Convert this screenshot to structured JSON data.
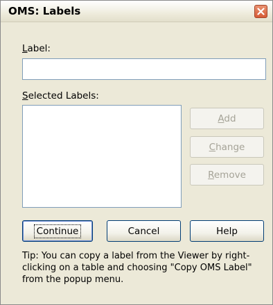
{
  "window": {
    "title": "OMS: Labels",
    "close_icon": "close-icon"
  },
  "form": {
    "label_field": {
      "label_mnemonic": "L",
      "label_rest": "abel:",
      "value": "",
      "placeholder": ""
    },
    "selected_labels": {
      "label_mnemonic": "S",
      "label_rest": "elected Labels:",
      "items": []
    }
  },
  "side_buttons": {
    "add": {
      "mnemonic": "A",
      "rest": "dd",
      "enabled": false
    },
    "change": {
      "mnemonic": "C",
      "rest": "hange",
      "enabled": false
    },
    "remove": {
      "mnemonic": "R",
      "rest": "emove",
      "enabled": false
    }
  },
  "bottom_buttons": {
    "continue": "Continue",
    "cancel": "Cancel",
    "help": "Help"
  },
  "tip": "Tip: You can copy a label from the Viewer by right-clicking on a table and choosing \"Copy OMS Label\" from the popup menu.",
  "colors": {
    "dialog_bg": "#ece9d8",
    "close_button": "#d65a36",
    "field_border": "#7f9db9"
  }
}
